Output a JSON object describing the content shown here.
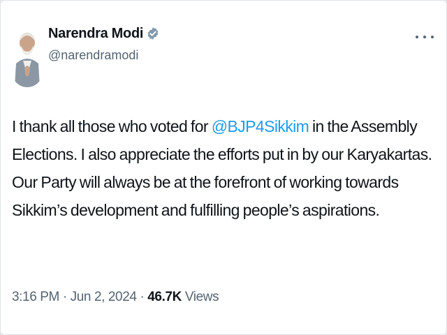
{
  "tweet": {
    "author_name": "Narendra Modi",
    "author_handle": "@narendramodi",
    "text_before": "I thank all those who voted for ",
    "mention": "@BJP4Sikkim",
    "text_after": " in the Assembly Elections. I also appreciate the efforts put in by our Karyakartas. Our Party will always be at the forefront of working towards Sikkim’s development and fulfilling people’s aspirations.",
    "time": "3:16 PM",
    "separator": " · ",
    "date": "Jun 2, 2024",
    "separator2": " · ",
    "views_count": "46.7K",
    "views_label": " Views"
  },
  "icons": {
    "verified": "verified-badge-icon",
    "more": "more-horizontal-icon"
  },
  "colors": {
    "text": "#0f1419",
    "secondary": "#536471",
    "link": "#1d9bf0",
    "verified": "#829aab"
  }
}
